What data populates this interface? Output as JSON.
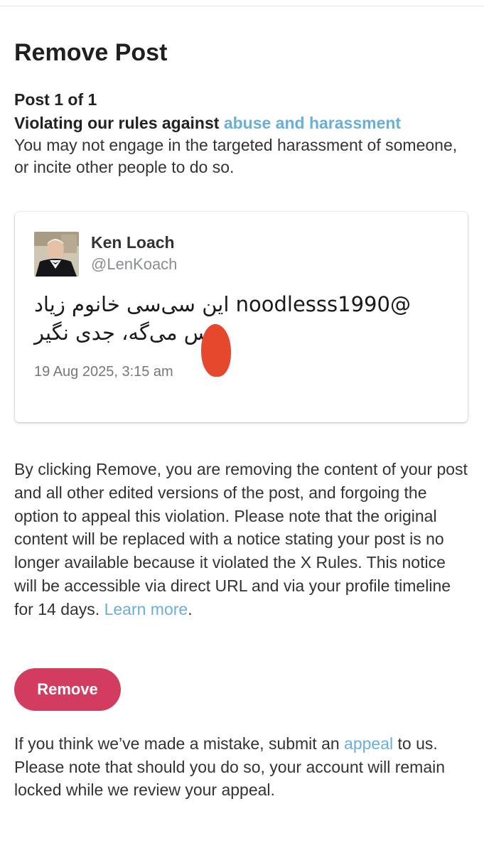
{
  "page": {
    "title": "Remove Post"
  },
  "violation": {
    "post_count": "Post 1 of 1",
    "rule_prefix": "Violating our rules against",
    "rule_link": "abuse and harassment",
    "rule_description": "You may not engage in the targeted harassment of someone, or incite other people to do so."
  },
  "post": {
    "author_name": "Ken Loach",
    "author_handle": "@LenKoach",
    "text_line1": "@noodlesss1990 این سی‌سی خانوم زیاد",
    "text_line2": "س می‌گه، جدی نگیر",
    "timestamp": "19 Aug 2025, 3:15 am"
  },
  "notice": {
    "body": "By clicking Remove, you are removing the content of your post and all other edited versions of the post, and forgoing the option to appeal this violation. Please note that the original content will be replaced with a notice stating your post is no longer available because it violated the X Rules. This notice will be accessible via direct URL and via your profile timeline for 14 days.",
    "learn_more": "Learn more",
    "period": "."
  },
  "actions": {
    "remove_label": "Remove"
  },
  "appeal": {
    "prefix": "If you think we’ve made a mistake, submit an",
    "link": "appeal",
    "suffix": "to us. Please note that should you do so, your account will remain locked while we review your appeal."
  },
  "colors": {
    "link": "#6aaedc",
    "remove_button": "#d23c5f",
    "redaction": "#e5482d"
  },
  "icons": {
    "avatar": "author-avatar-photo"
  }
}
